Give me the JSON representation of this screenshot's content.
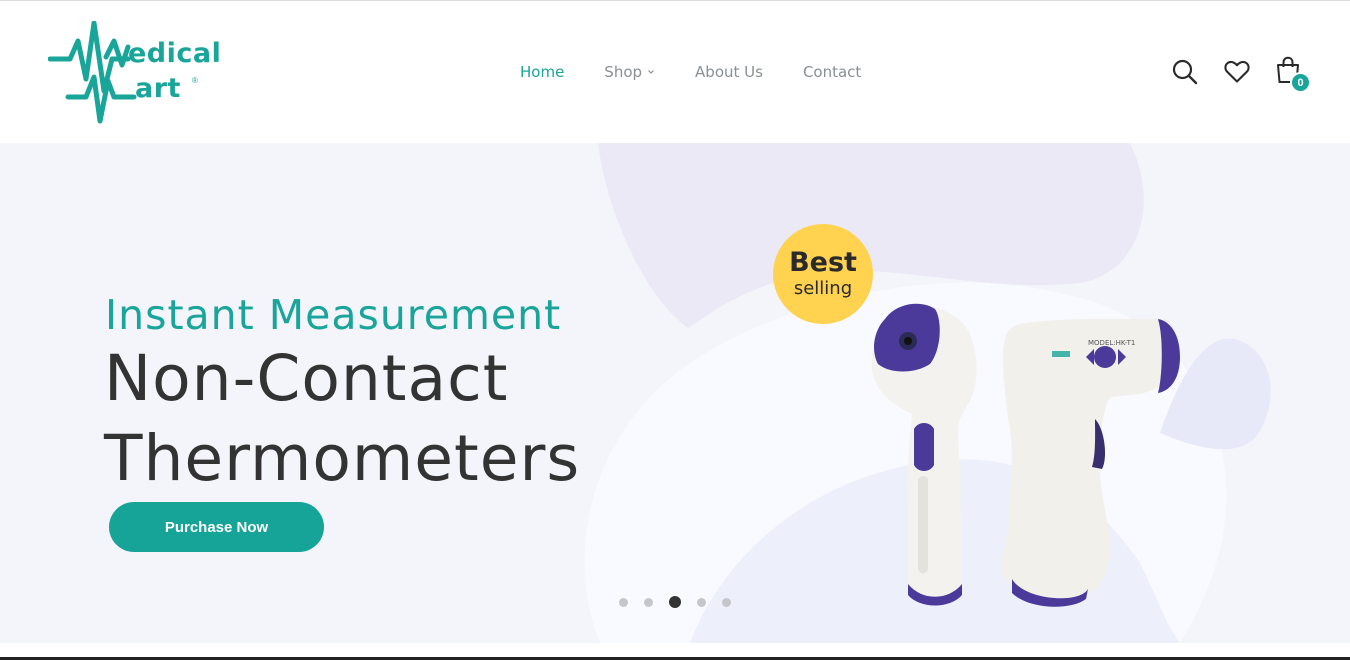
{
  "brand": {
    "logo_word_1": "edical",
    "logo_word_2": "art",
    "logo_mark": "®",
    "color": "#1aa59a"
  },
  "nav": {
    "items": [
      {
        "label": "Home",
        "active": true
      },
      {
        "label": "Shop",
        "active": false,
        "has_dropdown": true
      },
      {
        "label": "About Us",
        "active": false
      },
      {
        "label": "Contact",
        "active": false
      }
    ]
  },
  "header_icons": {
    "search": "search-icon",
    "wishlist": "heart-icon",
    "cart": "shopping-bag-icon",
    "cart_count": "0"
  },
  "hero": {
    "subtitle": "Instant Measurement",
    "title_line_1": "Non-Contact",
    "title_line_2": "Thermometers",
    "cta_label": "Purchase Now",
    "badge_line_1": "Best",
    "badge_line_2": "selling",
    "product_label_1": "MODEL:HK-T1",
    "slider": {
      "total": 5,
      "active_index": 2
    }
  },
  "colors": {
    "accent": "#1aa59a",
    "badge": "#ffd24f",
    "heading": "#333333",
    "product_purple": "#4b3a9a"
  }
}
